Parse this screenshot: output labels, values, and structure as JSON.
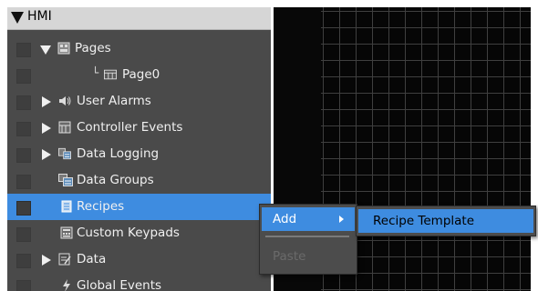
{
  "tree": {
    "root_label": "HMI",
    "items": [
      {
        "label": "Pages",
        "icon": "pages-icon",
        "expander": "expanded"
      },
      {
        "label": "Page0",
        "icon": "page-icon",
        "expander": "none"
      },
      {
        "label": "User Alarms",
        "icon": "speaker-icon",
        "expander": "collapsed"
      },
      {
        "label": "Controller Events",
        "icon": "controller-events-icon",
        "expander": "collapsed"
      },
      {
        "label": "Data Logging",
        "icon": "data-logging-icon",
        "expander": "collapsed"
      },
      {
        "label": "Data Groups",
        "icon": "data-groups-icon",
        "expander": "none"
      },
      {
        "label": "Recipes",
        "icon": "recipes-icon",
        "expander": "none",
        "selected": true
      },
      {
        "label": "Custom Keypads",
        "icon": "keypad-icon",
        "expander": "none"
      },
      {
        "label": "Data",
        "icon": "data-icon",
        "expander": "collapsed"
      },
      {
        "label": "Global Events",
        "icon": "lightning-icon",
        "expander": "none"
      }
    ]
  },
  "context_menu": {
    "add_label": "Add",
    "paste_label": "Paste"
  },
  "submenu": {
    "recipe_template_label": "Recipe Template"
  },
  "colors": {
    "selection": "#3e8ce0",
    "panel": "#4a4a4a",
    "canvas": "#060606",
    "grid_line": "#3f3f3f"
  }
}
